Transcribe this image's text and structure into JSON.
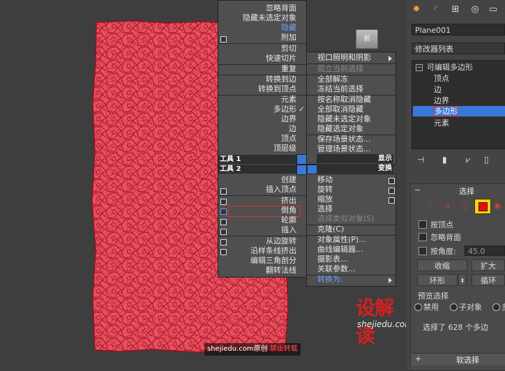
{
  "watermark": {
    "site": "shejiedu.com",
    "original": "原创",
    "forbid": "禁止转载"
  },
  "logo": {
    "title": "设解读",
    "url": "shejiedu.com"
  },
  "nav_cube": {
    "label": "前"
  },
  "menu_left": {
    "items": [
      {
        "label": "忽略背面"
      },
      {
        "label": "隐藏未选定对象"
      },
      {
        "label": "隐藏"
      },
      {
        "label": "附加"
      },
      {
        "label": "剪切"
      },
      {
        "label": "快速切片"
      },
      {
        "label": "重复"
      },
      {
        "label": "转换到边"
      },
      {
        "label": "转换到顶点"
      },
      {
        "label": "元素"
      },
      {
        "label": "多边形"
      },
      {
        "label": "边界"
      },
      {
        "label": "边"
      },
      {
        "label": "顶点"
      },
      {
        "label": "顶层级"
      }
    ],
    "tools1": "工具 1",
    "tools2": "工具 2",
    "lower": [
      {
        "label": "创建"
      },
      {
        "label": "插入顶点"
      },
      {
        "label": "挤出"
      },
      {
        "label": "倒角"
      },
      {
        "label": "轮廓"
      },
      {
        "label": "插入"
      },
      {
        "label": "从边旋转"
      },
      {
        "label": "沿样条线挤出"
      },
      {
        "label": "编辑三角剖分"
      },
      {
        "label": "翻转法线"
      }
    ]
  },
  "menu_right": {
    "upper": [
      {
        "label": "视口照明和阴影"
      },
      {
        "label": "孤立当前选择"
      },
      {
        "label": "全部解冻"
      },
      {
        "label": "冻结当前选择"
      },
      {
        "label": "按名称取消隐藏"
      },
      {
        "label": "全部取消隐藏"
      },
      {
        "label": "隐藏未选定对象"
      },
      {
        "label": "隐藏选定对象"
      },
      {
        "label": "保存场景状态..."
      },
      {
        "label": "管理场景状态..."
      }
    ],
    "display": "显示",
    "transform": "变换",
    "lower": [
      {
        "label": "移动"
      },
      {
        "label": "旋转"
      },
      {
        "label": "缩放"
      },
      {
        "label": "选择"
      },
      {
        "label": "选择类似对象(S)"
      },
      {
        "label": "克隆(C)"
      },
      {
        "label": "对象属性(P)..."
      },
      {
        "label": "曲线编辑器..."
      },
      {
        "label": "摄影表..."
      },
      {
        "label": "关联参数..."
      },
      {
        "label": "转换为:"
      }
    ]
  },
  "panel": {
    "object_name": "Plane001",
    "modifier_list": "修改器列表",
    "stack": [
      "可编辑多边形",
      "顶点",
      "边",
      "边界",
      "多边形",
      "元素"
    ],
    "rollout_selection": "选择",
    "by_vertex": "按顶点",
    "ignore_backfacing": "忽略背面",
    "by_angle": "按角度:",
    "angle_value": "45.0",
    "shrink": "收缩",
    "grow": "扩大",
    "ring": "环形",
    "loop": "循环",
    "preview_selection": "预览选择",
    "preview_off": "禁用",
    "preview_subobj": "子对象",
    "preview_multi": "多",
    "selected_status": "选择了 628 个多边",
    "soft_selection": "软选择",
    "colors": {
      "accent_blue": "#3a78d8",
      "mesh_fill": "#e8505f",
      "mesh_edge": "#9a0f1e",
      "viewport_border": "#e0a800"
    }
  }
}
